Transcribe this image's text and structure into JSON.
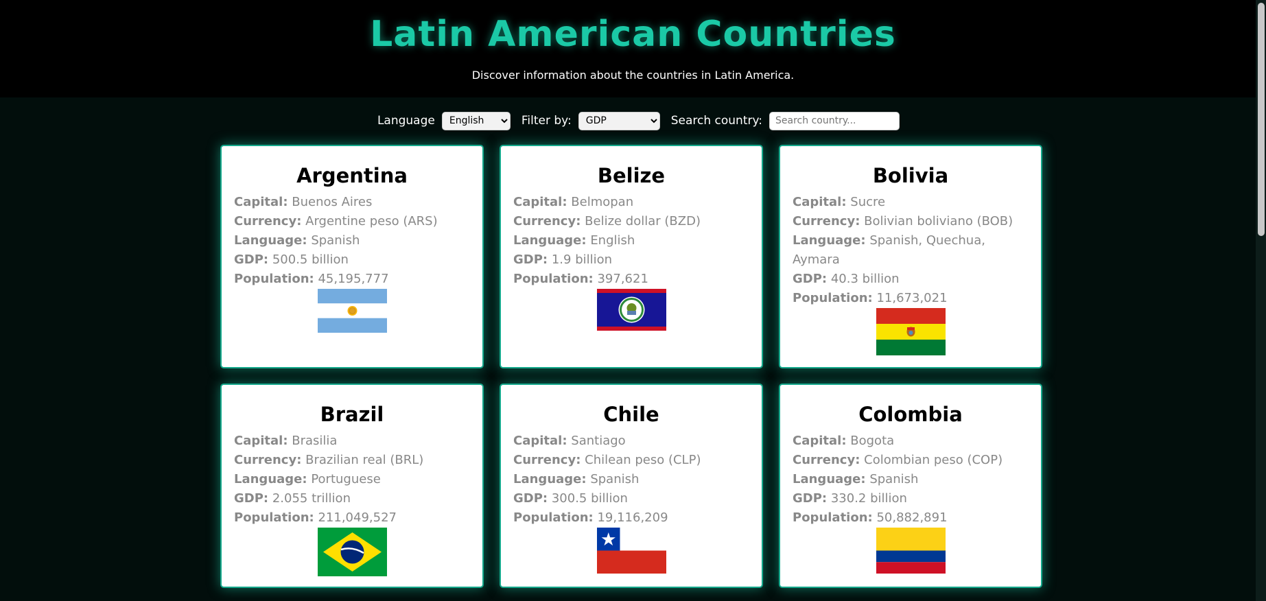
{
  "header": {
    "title": "Latin American Countries",
    "subtitle": "Discover information about the countries in Latin America."
  },
  "controls": {
    "language_label": "Language",
    "language_value": "English",
    "filter_label": "Filter by:",
    "filter_value": "GDP",
    "search_label": "Search country:",
    "search_placeholder": "Search country..."
  },
  "field_labels": {
    "capital": "Capital:",
    "currency": "Currency:",
    "language": "Language:",
    "gdp": "GDP:",
    "population": "Population:"
  },
  "countries": [
    {
      "name": "Argentina",
      "capital": "Buenos Aires",
      "currency": "Argentine peso (ARS)",
      "language": "Spanish",
      "gdp": "500.5 billion",
      "population": "45,195,777",
      "flag": "argentina-flag"
    },
    {
      "name": "Belize",
      "capital": "Belmopan",
      "currency": "Belize dollar (BZD)",
      "language": "English",
      "gdp": "1.9 billion",
      "population": "397,621",
      "flag": "belize-flag"
    },
    {
      "name": "Bolivia",
      "capital": "Sucre",
      "currency": "Bolivian boliviano (BOB)",
      "language": "Spanish, Quechua, Aymara",
      "gdp": "40.3 billion",
      "population": "11,673,021",
      "flag": "bolivia-flag"
    },
    {
      "name": "Brazil",
      "capital": "Brasilia",
      "currency": "Brazilian real (BRL)",
      "language": "Portuguese",
      "gdp": "2.055 trillion",
      "population": "211,049,527",
      "flag": "brazil-flag"
    },
    {
      "name": "Chile",
      "capital": "Santiago",
      "currency": "Chilean peso (CLP)",
      "language": "Spanish",
      "gdp": "300.5 billion",
      "population": "19,116,209",
      "flag": "chile-flag"
    },
    {
      "name": "Colombia",
      "capital": "Bogota",
      "currency": "Colombian peso (COP)",
      "language": "Spanish",
      "gdp": "330.2 billion",
      "population": "50,882,891",
      "flag": "colombia-flag"
    }
  ],
  "colors": {
    "accent": "#1bc9a6",
    "background": "#020e0c",
    "header_bg": "#000000",
    "card_text": "#888888"
  }
}
